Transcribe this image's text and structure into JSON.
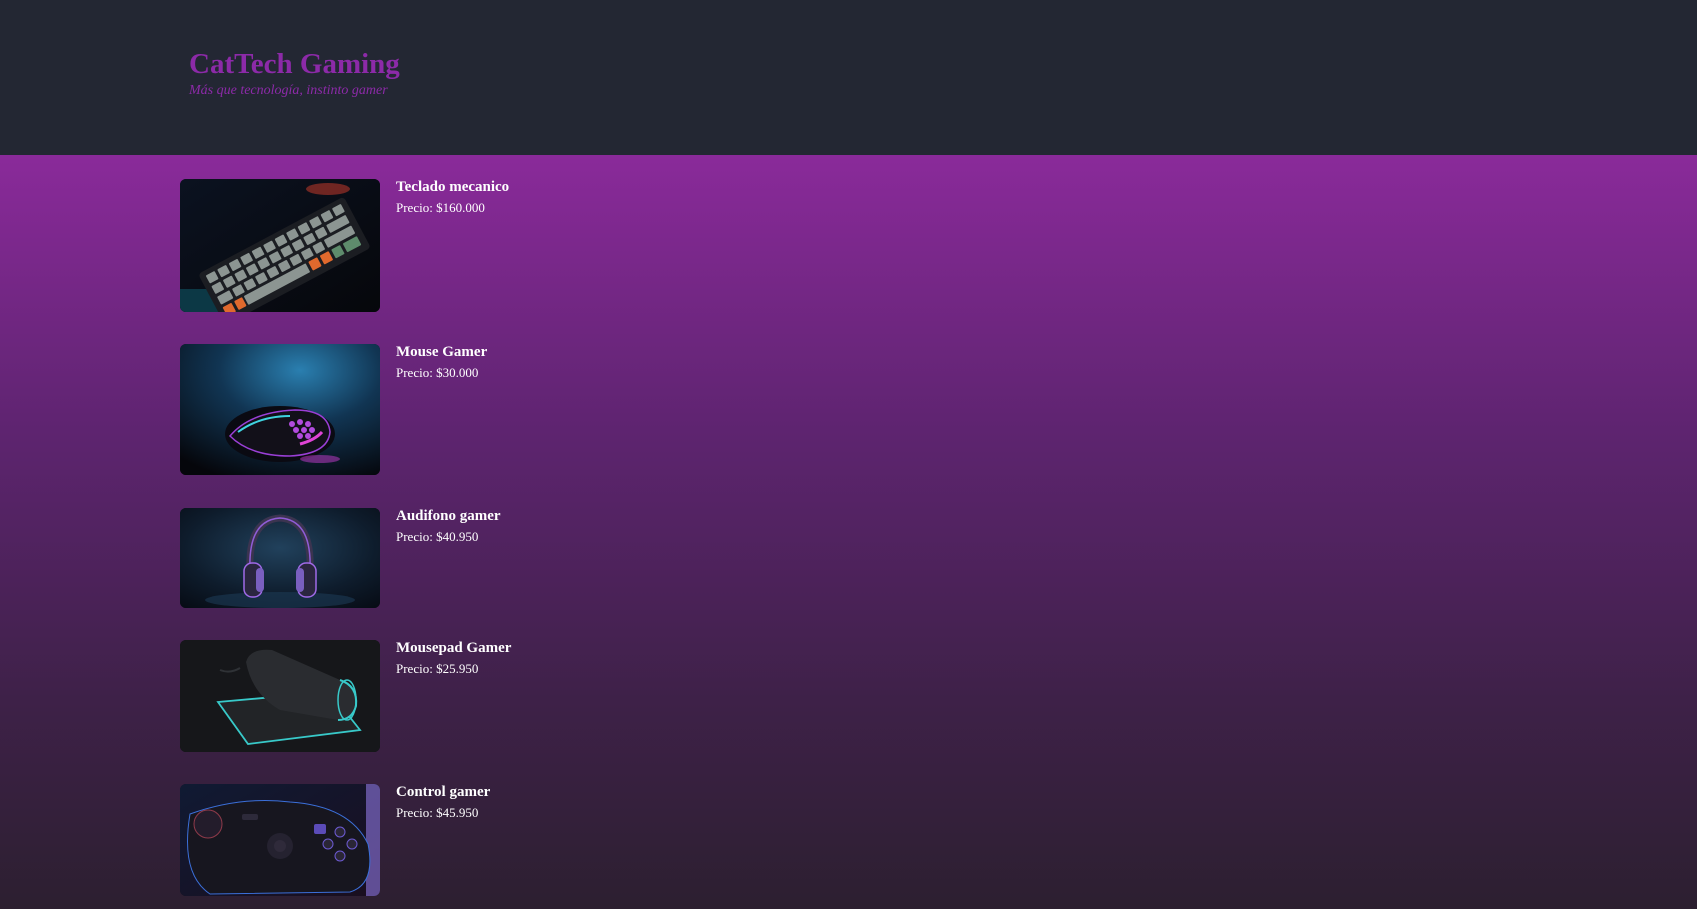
{
  "header": {
    "title": "CatTech Gaming",
    "tagline": "Más que tecnología, instinto gamer"
  },
  "products": [
    {
      "name": "Teclado mecanico",
      "price": "Precio: $160.000",
      "image_icon": "keyboard-image"
    },
    {
      "name": "Mouse Gamer",
      "price": "Precio: $30.000",
      "image_icon": "mouse-image"
    },
    {
      "name": "Audifono gamer",
      "price": "Precio: $40.950",
      "image_icon": "headphones-image"
    },
    {
      "name": "Mousepad Gamer",
      "price": "Precio: $25.950",
      "image_icon": "mousepad-image"
    },
    {
      "name": "Control gamer",
      "price": "Precio: $45.950",
      "image_icon": "gamepad-image"
    }
  ],
  "colors": {
    "header_bg": "#232733",
    "brand": "#8c2aa8",
    "text": "#ffffff"
  }
}
